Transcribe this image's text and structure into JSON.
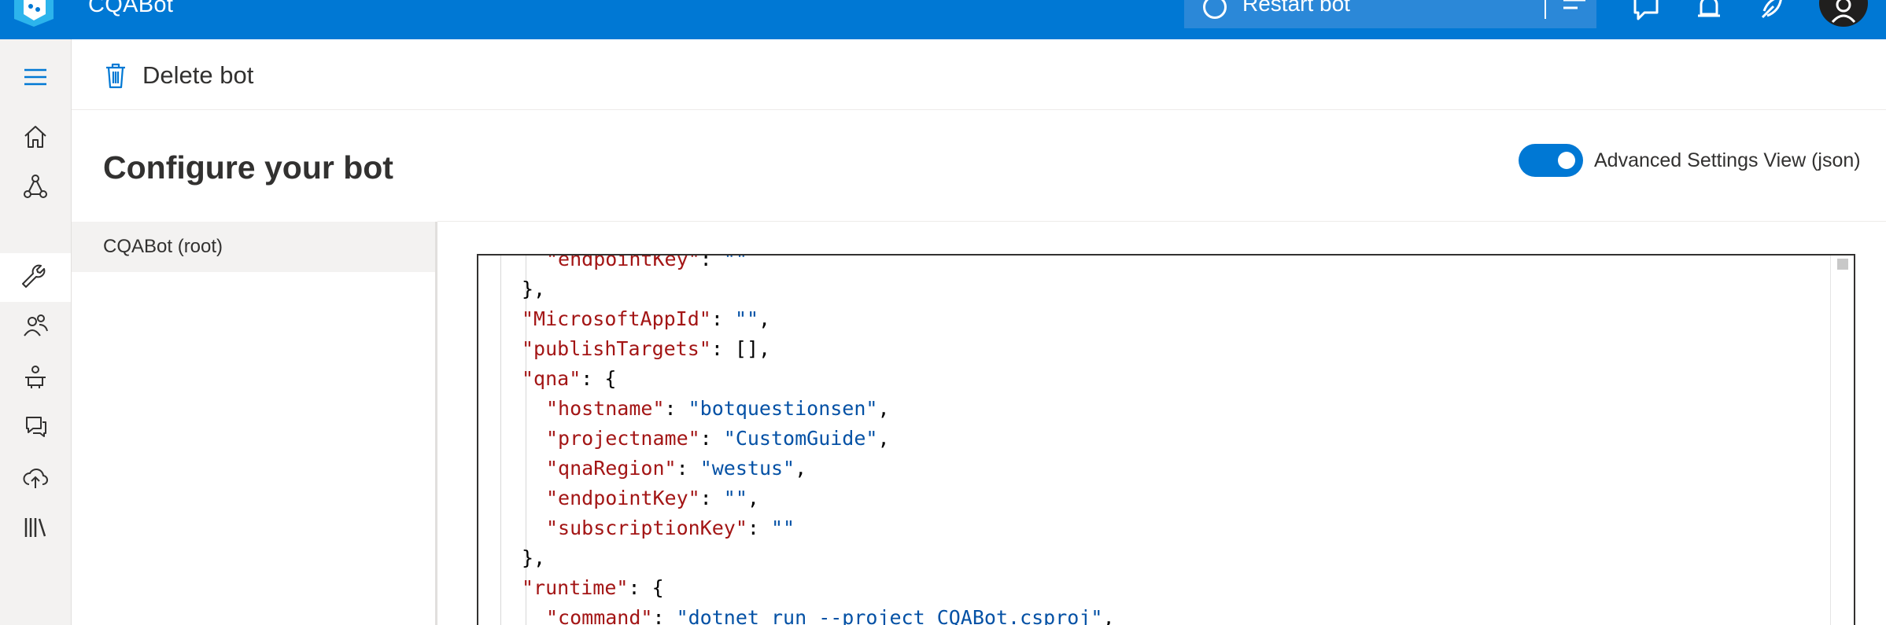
{
  "app": {
    "title": "CQABot"
  },
  "toolbar": {
    "restart_label": "Restart bot"
  },
  "command_bar": {
    "delete_label": "Delete bot"
  },
  "page": {
    "title": "Configure your bot",
    "advanced_toggle_label": "Advanced Settings View (json)",
    "advanced_toggle_on": true
  },
  "bots": [
    {
      "label": "CQABot (root)",
      "selected": true
    }
  ],
  "nav": {
    "active_index": 2,
    "items": [
      "home-icon",
      "bot-flow-icon",
      "wrench-icon",
      "users-icon",
      "bot-robot-icon",
      "chat-icon",
      "cloud-upload-icon",
      "library-icon"
    ]
  },
  "colors": {
    "accent": "#0078d4",
    "json_key": "#a31515",
    "json_string": "#0451a5"
  },
  "editor": {
    "lines": [
      {
        "indent": 1,
        "key": "\"endpointKey\"",
        "sep": ": ",
        "value": "\"\"",
        "tail": ""
      },
      {
        "indent": 0,
        "key": "",
        "sep": "",
        "value": "",
        "tail": "},"
      },
      {
        "indent": 0,
        "key": "\"MicrosoftAppId\"",
        "sep": ": ",
        "value": "\"\"",
        "tail": ","
      },
      {
        "indent": 0,
        "key": "\"publishTargets\"",
        "sep": ": [],",
        "value": "",
        "tail": ""
      },
      {
        "indent": 0,
        "key": "\"qna\"",
        "sep": ": {",
        "value": "",
        "tail": ""
      },
      {
        "indent": 1,
        "key": "\"hostname\"",
        "sep": ": ",
        "value": "\"botquestionsen\"",
        "tail": ","
      },
      {
        "indent": 1,
        "key": "\"projectname\"",
        "sep": ": ",
        "value": "\"CustomGuide\"",
        "tail": ","
      },
      {
        "indent": 1,
        "key": "\"qnaRegion\"",
        "sep": ": ",
        "value": "\"westus\"",
        "tail": ","
      },
      {
        "indent": 1,
        "key": "\"endpointKey\"",
        "sep": ": ",
        "value": "\"\"",
        "tail": ","
      },
      {
        "indent": 1,
        "key": "\"subscriptionKey\"",
        "sep": ": ",
        "value": "\"\"",
        "tail": ""
      },
      {
        "indent": 0,
        "key": "",
        "sep": "",
        "value": "",
        "tail": "},"
      },
      {
        "indent": 0,
        "key": "\"runtime\"",
        "sep": ": {",
        "value": "",
        "tail": ""
      },
      {
        "indent": 1,
        "key": "\"command\"",
        "sep": ": ",
        "value": "\"dotnet run --project CQABot.csproj\"",
        "tail": ","
      }
    ]
  }
}
